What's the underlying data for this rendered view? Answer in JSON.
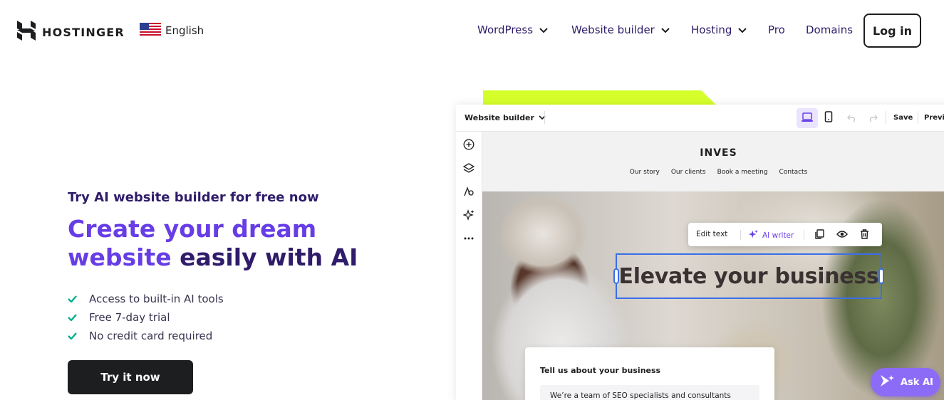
{
  "header": {
    "brand": "HOSTINGER",
    "language": "English",
    "menu": [
      {
        "label": "WordPress",
        "has_dropdown": true
      },
      {
        "label": "Website builder",
        "has_dropdown": true
      },
      {
        "label": "Hosting",
        "has_dropdown": true
      },
      {
        "label": "Pro",
        "has_dropdown": false
      },
      {
        "label": "Domains",
        "has_dropdown": false
      }
    ],
    "login_label": "Log in"
  },
  "hero": {
    "subheading": "Try AI website builder for free now",
    "headline_accent_1": "Create your dream",
    "headline_accent_2": "website",
    "headline_rest": " easily with AI",
    "features": [
      "Access to built-in AI tools",
      "Free 7-day trial",
      "No credit card required"
    ],
    "cta_label": "Try it now"
  },
  "builder": {
    "selector_label": "Website builder",
    "save_label": "Save",
    "preview_label": "Previ",
    "site": {
      "logo": "INVES",
      "nav": [
        "Our story",
        "Our clients",
        "Book a meeting",
        "Contacts"
      ]
    },
    "text_toolbar": {
      "edit_text": "Edit text",
      "ai_writer": "AI writer"
    },
    "hero_heading": "Elevate your business",
    "form_card": {
      "title": "Tell us about your business",
      "input_value": "We’re a team of SEO specialists and consultants"
    }
  },
  "ask_ai_label": "Ask AI",
  "colors": {
    "brand_purple": "#673de6",
    "dark_text": "#2f1c6a",
    "lime_accent": "#d5ff2a",
    "check_green": "#00b090",
    "selection_blue": "#3b6ee8"
  },
  "icons": [
    "hostinger-logo-icon",
    "us-flag-icon",
    "chevron-down-icon",
    "check-icon",
    "desktop-icon",
    "mobile-icon",
    "undo-icon",
    "redo-icon",
    "add-icon",
    "layers-icon",
    "theme-icon",
    "ai-sparkle-icon",
    "more-icon",
    "copy-icon",
    "eye-icon",
    "trash-icon",
    "ask-ai-icon"
  ]
}
